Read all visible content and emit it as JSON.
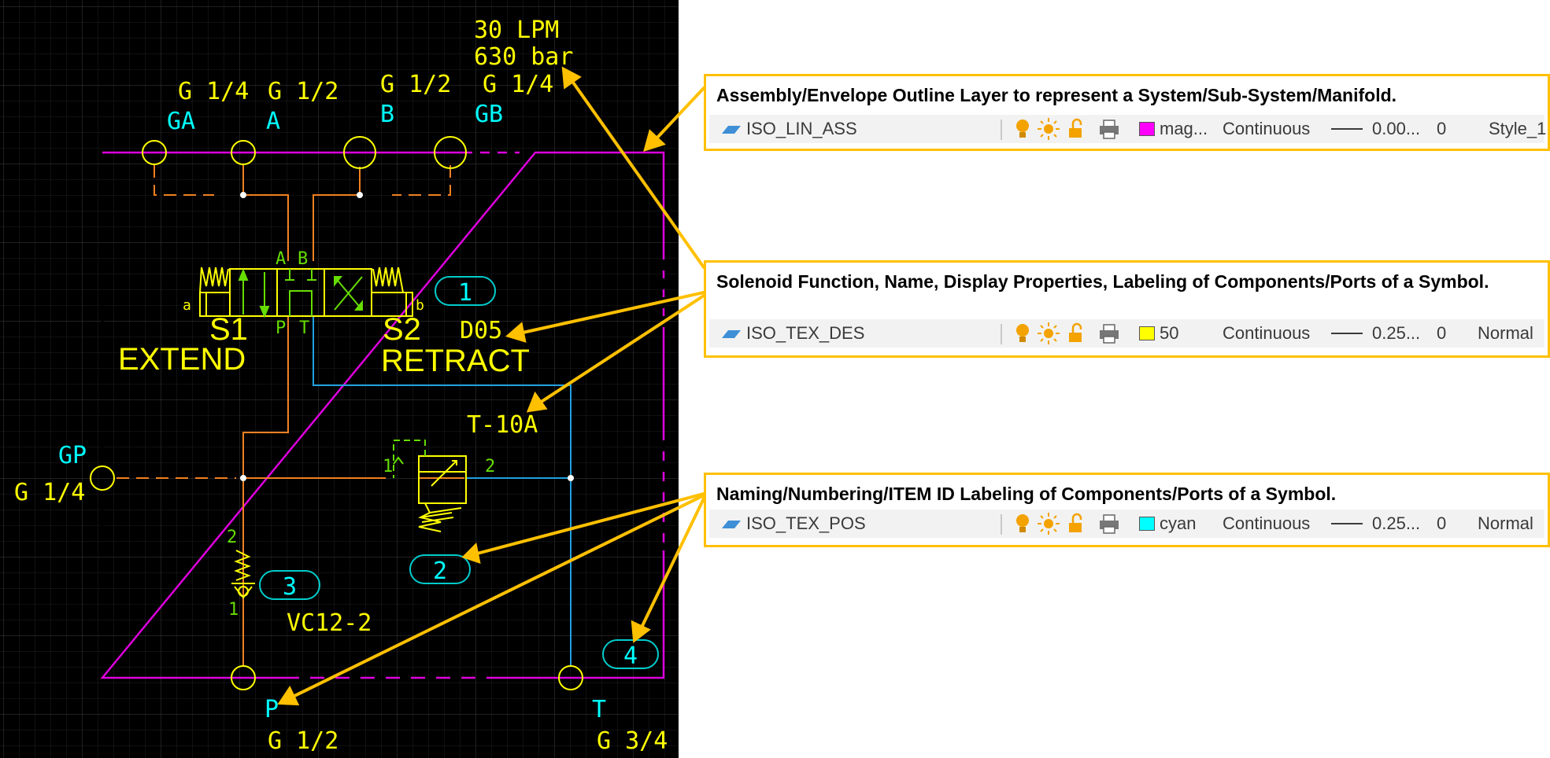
{
  "colors": {
    "cad_background": "#000000",
    "grid_line": "#2a2a2a",
    "envelope_magenta": "#dd00dd",
    "component_yellow": "#ffff00",
    "pressure_line_orange": "#f08020",
    "return_line_cyan": "#20a0e0",
    "label_cyan": "#00ffff",
    "label_green": "#66dd00",
    "callout_border": "#ffc000",
    "arrow": "#ffc000"
  },
  "schematic": {
    "flow_rating": "30 LPM",
    "pressure_rating": "630 bar",
    "ports_top": [
      {
        "size": "G 1/4",
        "name": "GA"
      },
      {
        "size": "G 1/2",
        "name": "A"
      },
      {
        "size": "G 1/2",
        "name": "B"
      },
      {
        "size": "G 1/4",
        "name": "GB"
      }
    ],
    "valve": {
      "port_A": "A",
      "port_B": "B",
      "port_P": "P",
      "port_T": "T",
      "solenoid_a": "a",
      "solenoid_b": "b",
      "sol1_name": "S1",
      "sol1_function": "EXTEND",
      "sol2_name": "S2",
      "sol2_function": "RETRACT",
      "model": "D05",
      "item_id": "1"
    },
    "relief_valve": {
      "model": "T-10A",
      "port_in": "1",
      "port_out": "2",
      "item_id": "2"
    },
    "check_valve": {
      "model": "VC12-2",
      "port_top": "2",
      "port_bottom": "1",
      "item_id": "3"
    },
    "manifold_item_id": "4",
    "port_gp": {
      "name": "GP",
      "size": "G 1/4"
    },
    "port_p": {
      "name": "P",
      "size": "G 1/2"
    },
    "port_t": {
      "name": "T",
      "size": "G 3/4"
    }
  },
  "callouts": [
    {
      "title": "Assembly/Envelope Outline Layer to represent a System/Sub-System/Manifold.",
      "layer": {
        "name": "ISO_LIN_ASS",
        "color_name": "mag...",
        "color_hex": "#ff00ff",
        "linetype": "Continuous",
        "lineweight": "0.00...",
        "transparency": "0",
        "plot_style": "Style_1"
      }
    },
    {
      "title": "Solenoid Function, Name, Display Properties, Labeling of Components/Ports of a Symbol.",
      "layer": {
        "name": "ISO_TEX_DES",
        "color_name": "50",
        "color_hex": "#ffff00",
        "linetype": "Continuous",
        "lineweight": "0.25...",
        "transparency": "0",
        "plot_style": "Normal"
      }
    },
    {
      "title": "Naming/Numbering/ITEM ID Labeling of Components/Ports of a Symbol.",
      "layer": {
        "name": "ISO_TEX_POS",
        "color_name": "cyan",
        "color_hex": "#00ffff",
        "linetype": "Continuous",
        "lineweight": "0.25...",
        "transparency": "0",
        "plot_style": "Normal"
      }
    }
  ],
  "layer_icons": [
    "layer-icon",
    "lightbulb-on-icon",
    "sun-thaw-icon",
    "unlocked-padlock-icon",
    "printer-icon"
  ]
}
